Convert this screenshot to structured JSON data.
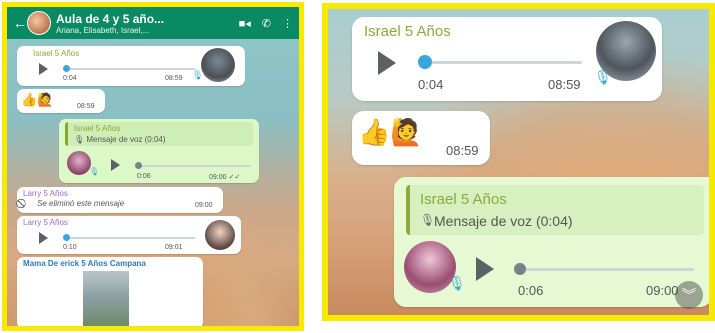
{
  "header": {
    "back_icon": "arrow-left-icon",
    "title": "Aula de 4 y 5 año...",
    "members": "Ariana, Elisabeth, Israel,...",
    "video_icon": "video-camera-icon",
    "call_icon": "phone-icon",
    "menu_icon": "more-vertical-icon"
  },
  "left": {
    "m1": {
      "sender": "Israel 5 Años",
      "elapsed": "0:04",
      "time": "08:59"
    },
    "m2": {
      "emojis": "👍🙋",
      "time": "08:59"
    },
    "m3": {
      "sender": "Israel 5 Años",
      "quote": "🎙 Mensaje de voz (0:04)",
      "elapsed": "0:06",
      "time": "09:00 ✓✓"
    },
    "m4": {
      "sender": "Larry 5 Años",
      "text": "Se eliminó este mensaje",
      "time": "09:00"
    },
    "m5": {
      "sender": "Larry 5 Años",
      "elapsed": "0:10",
      "time": "09:01"
    },
    "m6": {
      "sender": "Mama De erick 5 Años Campana"
    }
  },
  "right": {
    "m1": {
      "sender": "Israel 5 Años",
      "elapsed": "0:04",
      "time": "08:59"
    },
    "m2": {
      "emojis": "👍🙋",
      "time": "08:59"
    },
    "m3": {
      "sender": "Israel 5 Años",
      "quote": "Mensaje de voz (0:04)",
      "elapsed": "0:06",
      "time": "09:00"
    },
    "scroll_icon": "chevron-double-down-icon"
  },
  "colors": {
    "frame": "#f7ea00",
    "header": "#0a8a62",
    "accent_blue": "#3aa6d9",
    "sender_green": "#8ea83a"
  }
}
